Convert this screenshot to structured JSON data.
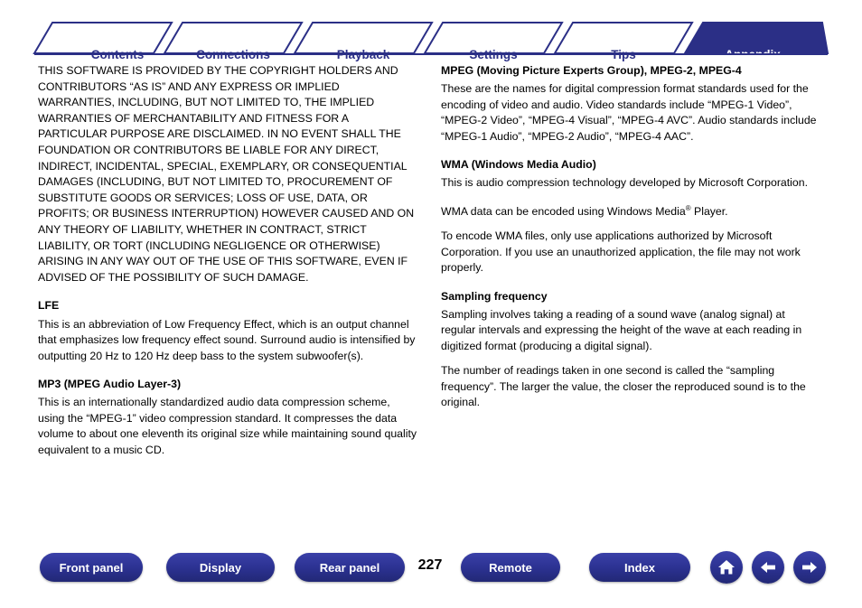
{
  "tabs": [
    {
      "label": "Contents",
      "active": false
    },
    {
      "label": "Connections",
      "active": false
    },
    {
      "label": "Playback",
      "active": false
    },
    {
      "label": "Settings",
      "active": false
    },
    {
      "label": "Tips",
      "active": false
    },
    {
      "label": "Appendix",
      "active": true
    }
  ],
  "theme": {
    "brand_blue": "#2b3190",
    "tab_text": "#2b2f86",
    "active_tab_text": "#ffffff",
    "page_background": "#ffffff"
  },
  "left_column": {
    "license_text": "THIS SOFTWARE IS PROVIDED BY THE COPYRIGHT HOLDERS AND CONTRIBUTORS “AS IS” AND ANY EXPRESS OR IMPLIED WARRANTIES, INCLUDING, BUT NOT LIMITED TO, THE IMPLIED WARRANTIES OF MERCHANTABILITY AND FITNESS FOR A PARTICULAR PURPOSE ARE DISCLAIMED. IN NO EVENT SHALL THE FOUNDATION OR CONTRIBUTORS BE LIABLE FOR ANY DIRECT, INDIRECT, INCIDENTAL, SPECIAL, EXEMPLARY, OR CONSEQUENTIAL DAMAGES (INCLUDING, BUT NOT LIMITED TO, PROCUREMENT OF SUBSTITUTE GOODS OR SERVICES; LOSS OF USE, DATA, OR PROFITS; OR BUSINESS INTERRUPTION) HOWEVER CAUSED AND ON ANY THEORY OF LIABILITY, WHETHER IN CONTRACT, STRICT LIABILITY, OR TORT (INCLUDING NEGLIGENCE OR OTHERWISE) ARISING IN ANY WAY OUT OF THE USE OF THIS SOFTWARE, EVEN IF ADVISED OF THE POSSIBILITY OF SUCH DAMAGE.",
    "lfe_heading": "LFE",
    "lfe_text": "This is an abbreviation of Low Frequency Effect, which is an output channel that emphasizes low frequency effect sound. Surround audio is intensified by outputting 20 Hz to 120 Hz deep bass to the system subwoofer(s).",
    "mp3_heading": "MP3 (MPEG Audio Layer-3)",
    "mp3_text": "This is an internationally standardized audio data compression scheme, using the “MPEG-1” video compression standard. It compresses the data volume to about one eleventh its original size while maintaining sound quality equivalent to a music CD."
  },
  "right_column": {
    "mpeg_heading": "MPEG (Moving Picture Experts Group), MPEG-2, MPEG-4",
    "mpeg_text": "These are the names for digital compression format standards used for the encoding of video and audio. Video standards include “MPEG-1 Video”, “MPEG-2 Video”, “MPEG-4 Visual”, “MPEG-4 AVC”. Audio standards include “MPEG-1 Audio”, “MPEG-2 Audio”, “MPEG-4 AAC”.",
    "wma_heading": "WMA (Windows Media Audio)",
    "wma_text_1": "This is audio compression technology developed by Microsoft Corporation.",
    "wma_text_2_pre": "WMA data can be encoded using Windows Media",
    "wma_text_2_sup": "®",
    "wma_text_2_post": " Player.",
    "wma_text_3": "To encode WMA files, only use applications authorized by Microsoft Corporation. If you use an unauthorized application, the file may not work properly.",
    "sampling_heading": "Sampling frequency",
    "sampling_text_1": "Sampling involves taking a reading of a sound wave (analog signal) at regular intervals and expressing the height of the wave at each reading in digitized format (producing a digital signal).",
    "sampling_text_2": "The number of readings taken in one second is called the “sampling frequency”. The larger the value, the closer the reproduced sound is to the original."
  },
  "footer": {
    "buttons": [
      {
        "label": "Front panel"
      },
      {
        "label": "Display"
      },
      {
        "label": "Rear panel"
      },
      {
        "label": "Remote"
      },
      {
        "label": "Index"
      }
    ],
    "page_number": "227",
    "icons": [
      {
        "name": "home-icon"
      },
      {
        "name": "arrow-left-icon"
      },
      {
        "name": "arrow-right-icon"
      }
    ]
  }
}
